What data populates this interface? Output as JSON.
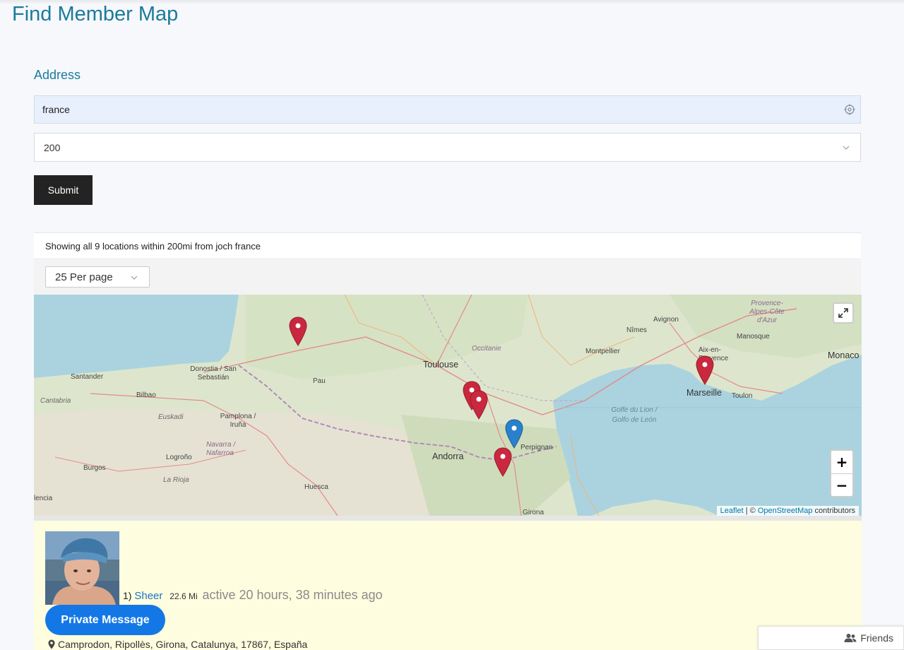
{
  "page": {
    "title": "Find Member Map"
  },
  "form": {
    "address_label": "Address",
    "address_value": "france",
    "radius_value": "200",
    "submit_label": "Submit"
  },
  "results": {
    "summary": "Showing all 9 locations within 200mi from joch france",
    "per_page": "25 Per page"
  },
  "map": {
    "labels": {
      "toulouse": "Toulouse",
      "occitanie": "Occitanie",
      "marseille": "Marseille",
      "montpellier": "Montpellier",
      "nimes": "Nîmes",
      "avignon": "Avignon",
      "aix": "Aix-en-Provence",
      "toulon": "Toulon",
      "manosque": "Manosque",
      "provence": "Provence-Alpes-Côte d'Azur",
      "monaco": "Monaco",
      "perpignan": "Perpignan",
      "andorra": "Andorra",
      "girona": "Girona",
      "huesca": "Huesca",
      "pau": "Pau",
      "donostia": "Donostia / San Sebastián",
      "santander": "Santander",
      "cantabria": "Cantabria",
      "bilbao": "Bilbao",
      "euskadi": "Euskadi",
      "pamplona": "Pamplona / Iruña",
      "navarra": "Navarra / Nafarroa",
      "logrono": "Logroño",
      "larioja": "La Rioja",
      "burgos": "Burgos",
      "palencia": "lencia",
      "golfe": "Golfe du Lion / Golfo de León"
    },
    "attribution": {
      "leaflet": "Leaflet",
      "sep": " | © ",
      "osm": "OpenStreetMap",
      "rest": " contributors"
    },
    "zoom_in": "+",
    "zoom_out": "−",
    "markers": [
      {
        "color": "#c9283e",
        "name": "marker-red-1"
      },
      {
        "color": "#c9283e",
        "name": "marker-red-2"
      },
      {
        "color": "#c9283e",
        "name": "marker-red-3"
      },
      {
        "color": "#c9283e",
        "name": "marker-red-4"
      },
      {
        "color": "#c9283e",
        "name": "marker-red-5"
      },
      {
        "color": "#2a81cb",
        "name": "marker-blue-home"
      }
    ]
  },
  "member": {
    "index": "1)",
    "name": "Sheer",
    "distance": "22.6 Mi",
    "active": "active 20 hours, 38 minutes ago",
    "pm_label": "Private Message",
    "address": "Camprodon, Ripollès, Girona, Catalunya, 17867, España"
  },
  "friends": {
    "label": "Friends"
  },
  "colors": {
    "accent": "#1d7a9c",
    "button_dark": "#232323",
    "pm_blue": "#1378e6",
    "card_bg": "#fffddf"
  }
}
